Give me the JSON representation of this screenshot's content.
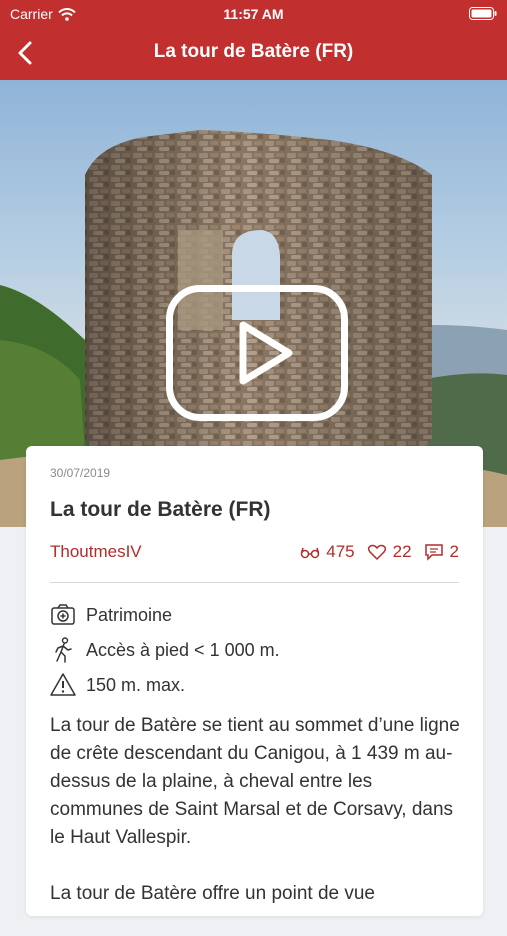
{
  "status": {
    "carrier": "Carrier",
    "time": "11:57 AM"
  },
  "nav": {
    "title": "La tour de Batère (FR)"
  },
  "card": {
    "date": "30/07/2019",
    "title": "La tour de Batère (FR)",
    "author": "ThoutmesIV",
    "views": "475",
    "likes": "22",
    "comments": "2",
    "category": "Patrimoine",
    "access": "Accès à pied < 1 000 m.",
    "distance": "150 m. max.",
    "desc1": "La tour de Batère se tient au sommet d’une ligne de crête descendant du Canigou, à 1 439 m au-dessus de la plaine, à cheval entre les communes de Saint Marsal et de Corsavy, dans le Haut Vallespir.",
    "desc2": "La tour de Batère offre un point de vue"
  },
  "colors": {
    "brand": "#c22f2f",
    "accent_text": "#b22c2c"
  },
  "icons": [
    "back-chevron-icon",
    "wifi-icon",
    "battery-icon",
    "play-icon",
    "glasses-icon",
    "heart-icon",
    "comment-icon",
    "camera-icon",
    "hiker-icon",
    "warning-icon"
  ]
}
